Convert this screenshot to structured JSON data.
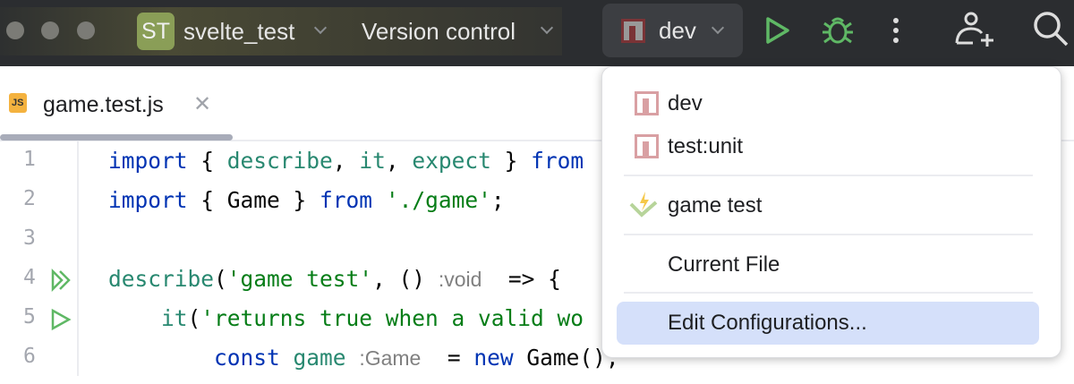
{
  "toolbar": {
    "project_badge": "ST",
    "project_name": "svelte_test",
    "vcs_label": "Version control",
    "run_config": "dev"
  },
  "tab": {
    "file_name": "game.test.js",
    "js_badge": "JS"
  },
  "code": [
    {
      "n": "1",
      "tokens": [
        [
          "kw",
          "import"
        ],
        [
          "plain",
          " { "
        ],
        [
          "fn",
          "describe"
        ],
        [
          "plain",
          ", "
        ],
        [
          "fn",
          "it"
        ],
        [
          "plain",
          ", "
        ],
        [
          "fn",
          "expect"
        ],
        [
          "plain",
          " } "
        ],
        [
          "kw",
          "from"
        ]
      ]
    },
    {
      "n": "2",
      "tokens": [
        [
          "kw",
          "import"
        ],
        [
          "plain",
          " { Game } "
        ],
        [
          "kw",
          "from"
        ],
        [
          "plain",
          " "
        ],
        [
          "str",
          "'./game'"
        ],
        [
          "plain",
          ";"
        ]
      ]
    },
    {
      "n": "3",
      "tokens": []
    },
    {
      "n": "4",
      "tokens": [
        [
          "fn",
          "describe"
        ],
        [
          "plain",
          "("
        ],
        [
          "str",
          "'game test'"
        ],
        [
          "plain",
          ", () "
        ],
        [
          "hint",
          ":void"
        ],
        [
          "plain",
          "  => {"
        ]
      ]
    },
    {
      "n": "5",
      "tokens": [
        [
          "plain",
          "    "
        ],
        [
          "fn",
          "it"
        ],
        [
          "plain",
          "("
        ],
        [
          "str",
          "'returns true when a valid wo"
        ]
      ]
    },
    {
      "n": "6",
      "tokens": [
        [
          "plain",
          "        "
        ],
        [
          "kw",
          "const"
        ],
        [
          "plain",
          " "
        ],
        [
          "fn",
          "game"
        ],
        [
          "plain",
          " "
        ],
        [
          "hint",
          ":Game"
        ],
        [
          "plain",
          "  = "
        ],
        [
          "kw",
          "new"
        ],
        [
          "plain",
          " Game(),"
        ]
      ]
    }
  ],
  "menu": {
    "items": [
      {
        "label": "dev",
        "icon": "npm-icon"
      },
      {
        "label": "test:unit",
        "icon": "npm-icon"
      },
      {
        "label": "game test",
        "icon": "vitest-icon"
      },
      {
        "label": "Current File",
        "icon": ""
      },
      {
        "label": "Edit Configurations...",
        "icon": "",
        "selected": true
      }
    ]
  },
  "colors": {
    "accent_run": "#5fb865",
    "npm": "#c94f4f",
    "selection": "#d5e0fa"
  }
}
